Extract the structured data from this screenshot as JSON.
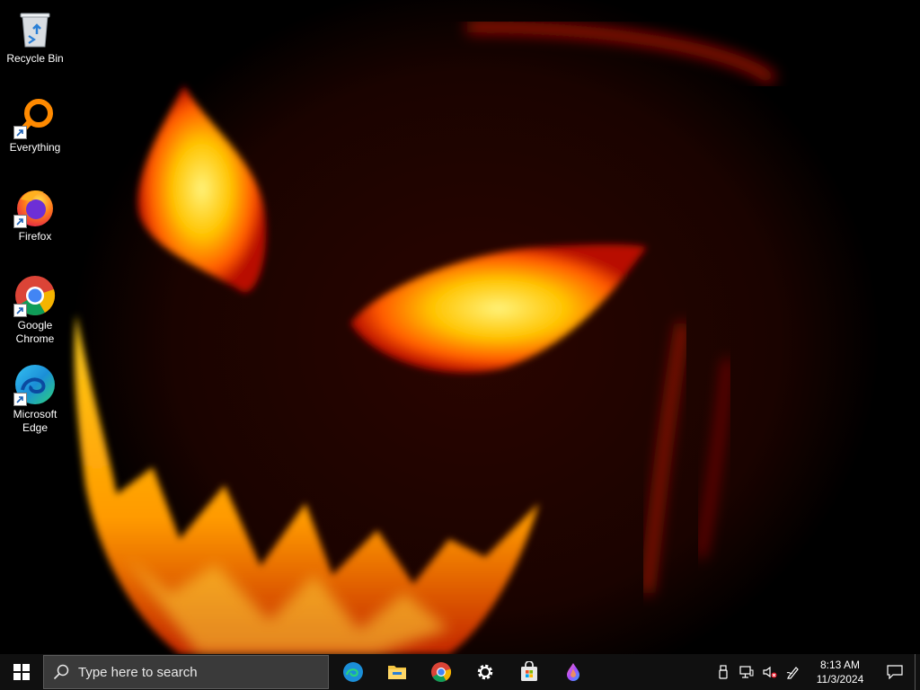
{
  "desktop": {
    "icons": [
      {
        "label": "Recycle Bin",
        "icon": "recycle-bin-icon"
      },
      {
        "label": "Everything",
        "icon": "everything-search-icon"
      },
      {
        "label": "Firefox",
        "icon": "firefox-icon"
      },
      {
        "label": "Google Chrome",
        "icon": "chrome-icon"
      },
      {
        "label": "Microsoft Edge",
        "icon": "edge-icon"
      }
    ]
  },
  "taskbar": {
    "search_placeholder": "Type here to search",
    "pinned": [
      {
        "name": "Microsoft Edge",
        "icon": "edge-icon"
      },
      {
        "name": "File Explorer",
        "icon": "folder-icon"
      },
      {
        "name": "Google Chrome",
        "icon": "chrome-icon"
      },
      {
        "name": "Settings",
        "icon": "gear-icon"
      },
      {
        "name": "Microsoft Store",
        "icon": "store-icon"
      },
      {
        "name": "Paint",
        "icon": "paint-drop-icon"
      }
    ],
    "tray": {
      "time": "8:13 AM",
      "date": "11/3/2024",
      "icons": [
        "usb-icon",
        "network-icon",
        "volume-muted-icon",
        "pen-icon",
        "notification-icon"
      ]
    }
  },
  "colors": {
    "taskbar_bg": "#101010",
    "search_bg": "#3a3a3a",
    "wallpaper_glow": "#ffb000",
    "wallpaper_edge": "#cc1800"
  }
}
